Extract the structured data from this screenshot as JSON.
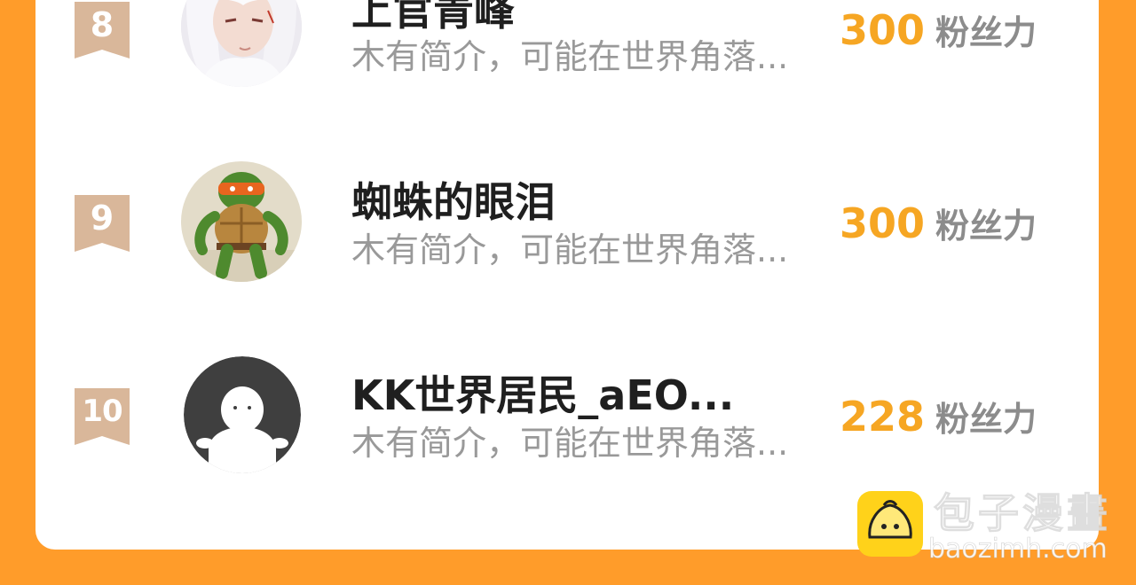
{
  "colors": {
    "background": "#FF9C2A",
    "card": "#FFFFFF",
    "fans_number": "#F6A623",
    "rank_badge": "#D9B79A"
  },
  "ranking": [
    {
      "rank": "8",
      "name": "上官青峰",
      "intro": "木有简介，可能在世界角落...",
      "fans": "300",
      "fans_unit": "粉丝力",
      "avatar": "white-haired-character-avatar"
    },
    {
      "rank": "9",
      "name": "蜘蛛的眼泪",
      "intro": "木有简介，可能在世界角落...",
      "fans": "300",
      "fans_unit": "粉丝力",
      "avatar": "ninja-turtle-figure-avatar"
    },
    {
      "rank": "10",
      "name": "KK世界居民_aEO...",
      "intro": "木有简介，可能在世界角落...",
      "fans": "228",
      "fans_unit": "粉丝力",
      "avatar": "default-user-avatar"
    }
  ],
  "watermark": {
    "title": "包子漫畫",
    "url": "baozimh.com",
    "logo": "bun-face-logo"
  }
}
